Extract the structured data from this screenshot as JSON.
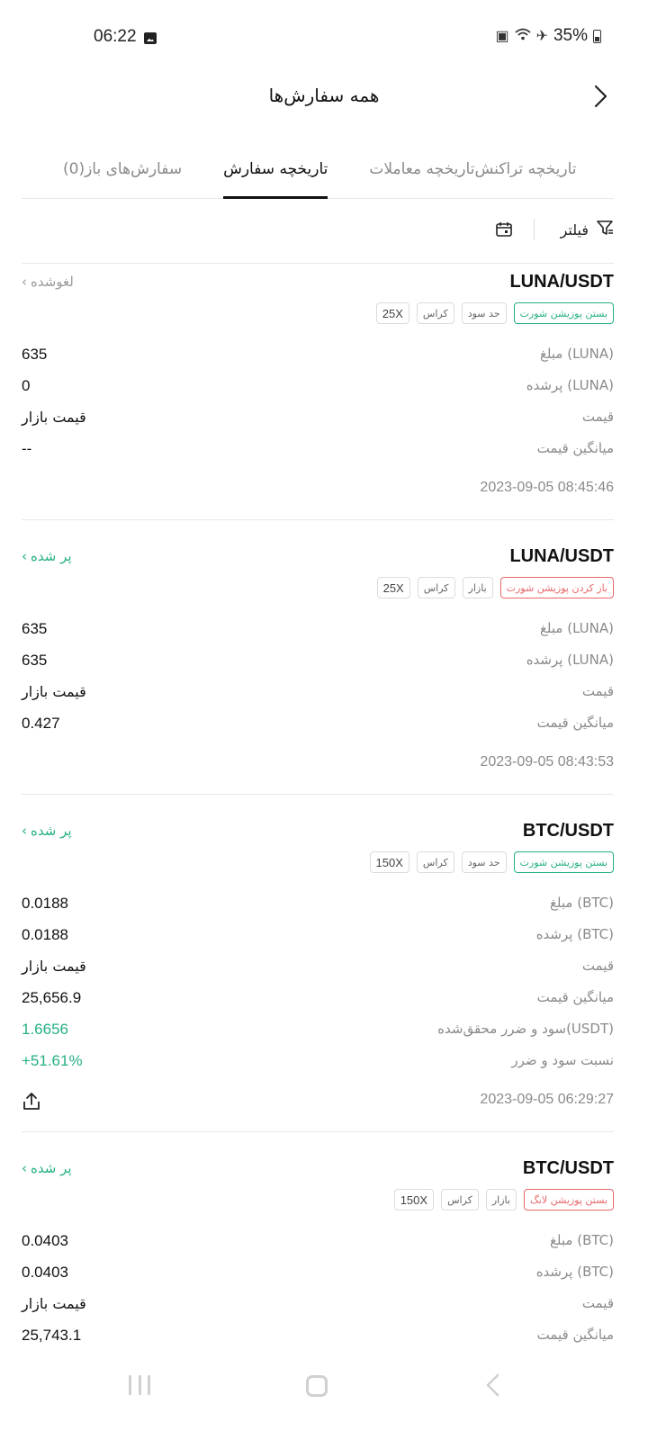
{
  "status_bar": {
    "time": "06:22",
    "battery": "35%",
    "icons": [
      "image-icon",
      "battery-saver-icon",
      "wifi-icon",
      "airplane-icon",
      "battery-icon"
    ]
  },
  "header": {
    "title": "همه سفارش‌ها",
    "back_icon": "chevron-right-icon"
  },
  "tabs": [
    {
      "label": "سفارش‌های باز(0)",
      "active": false
    },
    {
      "label": "تاریخچه سفارش",
      "active": true
    },
    {
      "label": "تاریخچه معاملات",
      "active": false
    },
    {
      "label": "تاریخچه تراکنش",
      "active": false
    }
  ],
  "toolbar": {
    "filter_label": "فیلتر",
    "filter_icon": "filter-icon",
    "calendar_icon": "calendar-icon"
  },
  "orders": [
    {
      "pair": "LUNA/USDT",
      "status": "لغوشده",
      "status_color": "#9a9a9a",
      "tags": [
        "بستن پوزیشن شورت",
        "حد سود",
        "کراس",
        "25X"
      ],
      "rows": [
        {
          "label": "مبلغ (LUNA)",
          "value": "635"
        },
        {
          "label": "پرشده (LUNA)",
          "value": "0"
        },
        {
          "label": "قیمت",
          "value": "قیمت بازار"
        },
        {
          "label": "میانگین قیمت",
          "value": "--"
        }
      ],
      "time": "2023-09-05 08:45:46"
    },
    {
      "pair": "LUNA/USDT",
      "status": "پر شده",
      "status_color": "#25b086",
      "tags": [
        "باز کردن پوزیشن شورت",
        "بازار",
        "کراس",
        "25X"
      ],
      "rows": [
        {
          "label": "مبلغ (LUNA)",
          "value": "635"
        },
        {
          "label": "پرشده (LUNA)",
          "value": "635"
        },
        {
          "label": "قیمت",
          "value": "قیمت بازار"
        },
        {
          "label": "میانگین قیمت",
          "value": "0.427"
        }
      ],
      "time": "2023-09-05 08:43:53"
    },
    {
      "pair": "BTC/USDT",
      "status": "پر شده",
      "status_color": "#25b086",
      "tags": [
        "بستن پوزیشن شورت",
        "حد سود",
        "کراس",
        "150X"
      ],
      "rows": [
        {
          "label": "مبلغ (BTC)",
          "value": "0.0188"
        },
        {
          "label": "پرشده (BTC)",
          "value": "0.0188"
        },
        {
          "label": "قیمت",
          "value": "قیمت بازار"
        },
        {
          "label": "میانگین قیمت",
          "value": "25,656.9"
        },
        {
          "label": "سود و ضرر محقق‌شده(USDT)",
          "value": "1.6656"
        },
        {
          "label": "نسبت سود و ضرر",
          "value": "+51.61%"
        }
      ],
      "time": "2023-09-05 06:29:27",
      "share_icon": "share-icon"
    },
    {
      "pair": "BTC/USDT",
      "status": "پر شده",
      "status_color": "#25b086",
      "tags": [
        "بستن پوزیشن لانگ",
        "بازار",
        "کراس",
        "150X"
      ],
      "rows": [
        {
          "label": "مبلغ (BTC)",
          "value": "0.0403"
        },
        {
          "label": "پرشده (BTC)",
          "value": "0.0403"
        },
        {
          "label": "قیمت",
          "value": "قیمت بازار"
        },
        {
          "label": "میانگین قیمت",
          "value": "25,743.1"
        }
      ]
    }
  ],
  "colors": {
    "accent_green": "#25b086",
    "accent_red": "#e8676b",
    "muted_text": "#8a8a8a"
  },
  "nav_bar": {
    "icons": [
      "recent-apps-icon",
      "home-icon",
      "back-icon"
    ]
  }
}
